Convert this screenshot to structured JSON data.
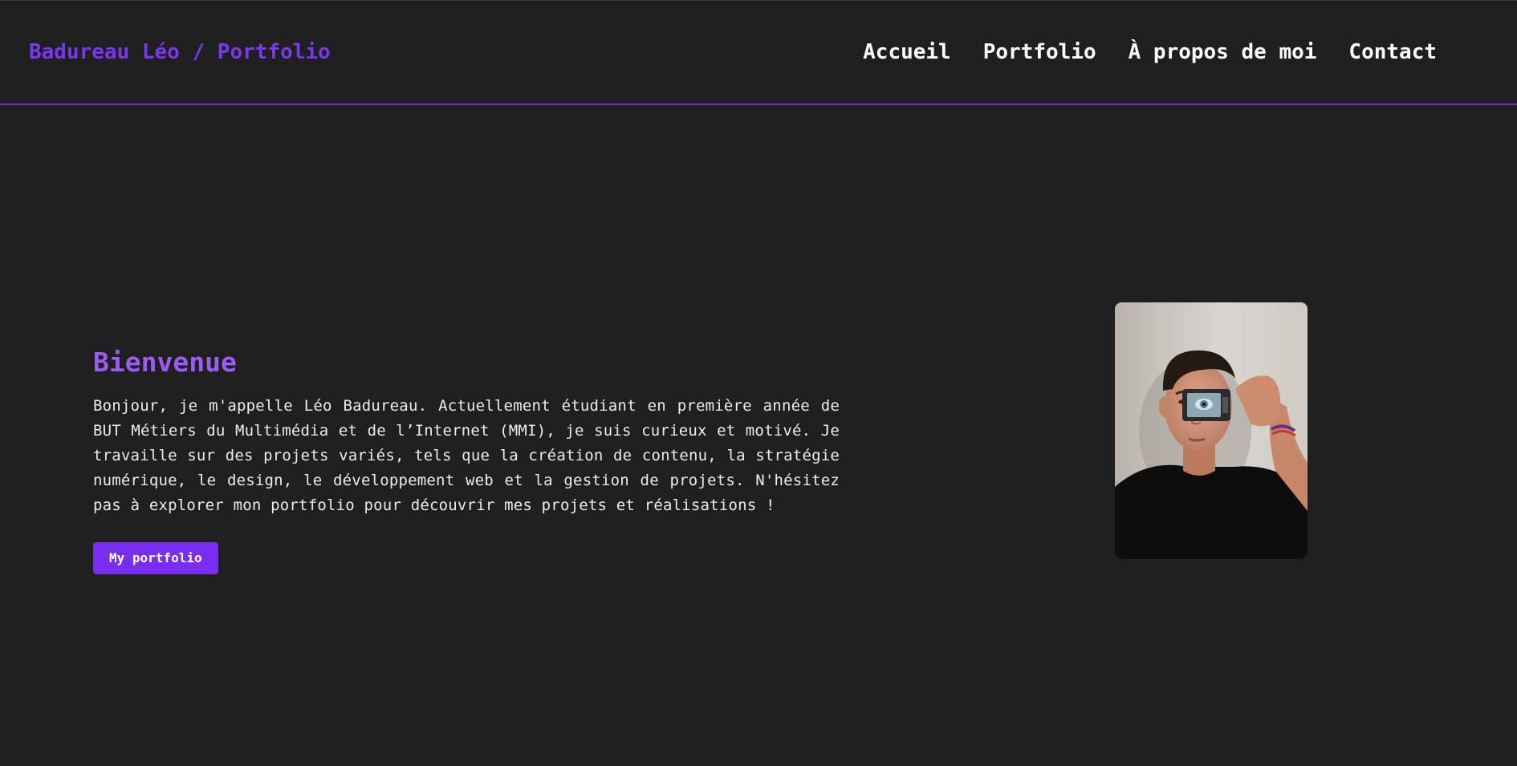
{
  "header": {
    "brand": "Badureau Léo / Portfolio",
    "nav": [
      {
        "label": "Accueil"
      },
      {
        "label": "Portfolio"
      },
      {
        "label": "À propos de moi"
      },
      {
        "label": "Contact"
      }
    ]
  },
  "hero": {
    "title": "Bienvenue",
    "paragraph": "Bonjour, je m'appelle Léo Badureau. Actuellement étudiant en première année de BUT Métiers du Multimédia et de l’Internet (MMI), je suis curieux et motivé. Je travaille sur des projets variés, tels que la création de contenu, la stratégie numérique, le design, le développement web et la gestion de projets. N'hésitez pas à explorer mon portfolio pour découvrir mes projets et réalisations !",
    "button_label": "My portfolio"
  },
  "colors": {
    "background": "#1f1f1f",
    "accent": "#7a36f0",
    "title": "#9a5cf5",
    "text": "#ececec"
  }
}
